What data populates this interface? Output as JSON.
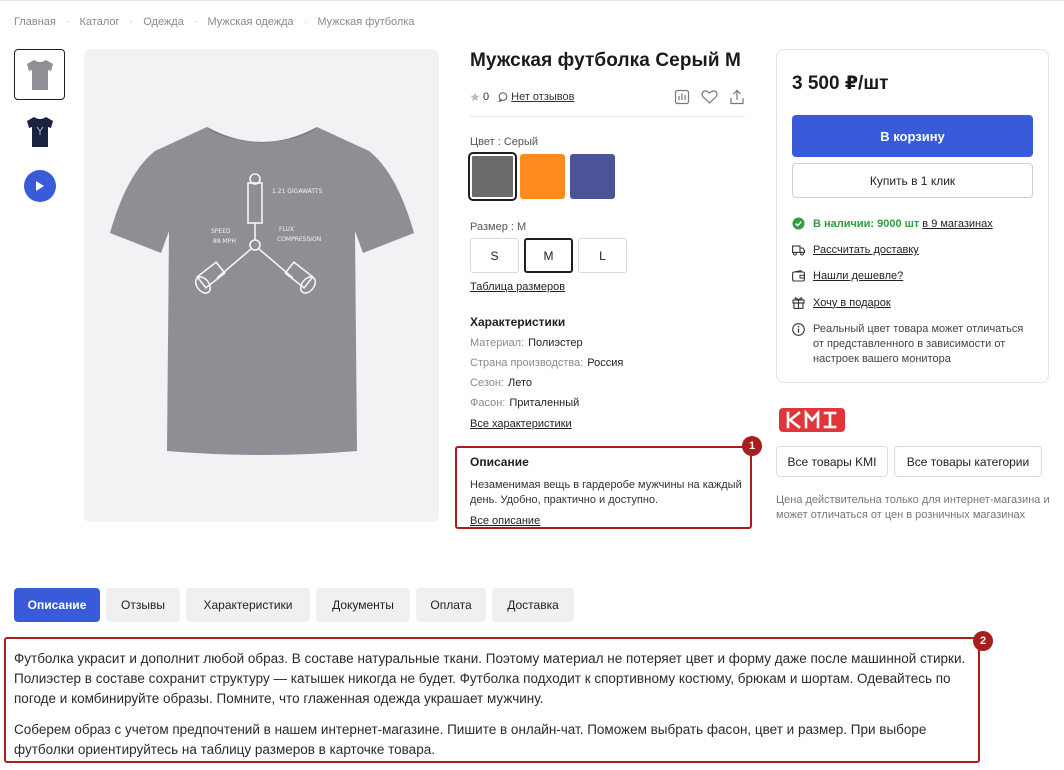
{
  "breadcrumb": [
    "Главная",
    "Каталог",
    "Одежда",
    "Мужская одежда",
    "Мужская футболка"
  ],
  "product": {
    "title": "Мужская футболка Серый M",
    "rating": "0",
    "reviews_link": "Нет отзывов"
  },
  "color": {
    "label": "Цвет : Серый",
    "options": [
      {
        "name": "Серый",
        "hex": "#6b6b6b",
        "selected": true
      },
      {
        "name": "Оранжевый",
        "hex": "#ff8a1f",
        "selected": false
      },
      {
        "name": "Синий",
        "hex": "#4a5496",
        "selected": false
      }
    ]
  },
  "size": {
    "label": "Размер : M",
    "options": [
      "S",
      "M",
      "L"
    ],
    "selected": "M",
    "table_link": "Таблица размеров"
  },
  "characteristics": {
    "title": "Характеристики",
    "rows": [
      {
        "key": "Материал:",
        "value": "Полиэстер"
      },
      {
        "key": "Страна производства:",
        "value": "Россия"
      },
      {
        "key": "Сезон:",
        "value": "Лето"
      },
      {
        "key": "Фасон:",
        "value": "Приталенный"
      }
    ],
    "all_link": "Все характеристики"
  },
  "short_description": {
    "title": "Описание",
    "text": "Незаменимая вещь в гардеробе мужчины на каждый день. Удобно, практично и доступно.",
    "link": "Все описание",
    "badge": "1"
  },
  "buybox": {
    "price": "3 500 ₽/шт",
    "cart_button": "В корзину",
    "one_click_button": "Купить в 1 клик",
    "stock_prefix": "В наличии: 9000 шт",
    "stock_suffix": "в 9 магазинах",
    "delivery": "Рассчитать доставку",
    "cheaper": "Нашли дешевле?",
    "gift": "Хочу в подарок",
    "note": "Реальный цвет товара может отличаться от представленного в зависимости от настроек вашего монитора"
  },
  "brand": {
    "logo_text": "KMI",
    "all_brand_button": "Все товары KMI",
    "all_category_button": "Все товары категории",
    "price_note": "Цена действительна только для интернет-магазина и может отличаться от цен в розничных магазинах"
  },
  "tabs": [
    "Описание",
    "Отзывы",
    "Характеристики",
    "Документы",
    "Оплата",
    "Доставка"
  ],
  "long_description": {
    "badge": "2",
    "p1": "Футболка украсит и дополнит любой образ. В составе натуральные ткани. Поэтому материал не потеряет цвет и форму даже после машинной стирки. Полиэстер в составе сохранит структуру — катышек никогда не будет. Футболка подходит к спортивному костюму, брюкам и шортам. Одевайтесь по погоде и комбинируйте образы. Помните, что глаженная одежда украшает мужчину.",
    "p2": "Соберем образ с учетом предпочтений в нашем интернет-магазине. Пишите в онлайн-чат. Поможем выбрать фасон, цвет и размер. При выборе футболки ориентируйтесь на таблицу размеров в карточке товара."
  },
  "colors": {
    "accent": "#3a5bd9",
    "highlight": "#a81d1d",
    "stock": "#2e9e3f",
    "brand": "#e0353a"
  }
}
